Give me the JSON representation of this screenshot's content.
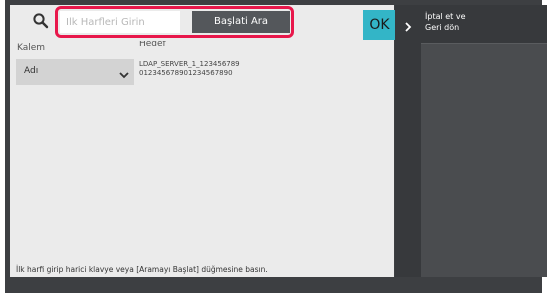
{
  "search": {
    "placeholder": "İlk Harfleri Girin",
    "value": "",
    "start_button_label": "Başlati Ara"
  },
  "ok_label": "OK",
  "columns": {
    "item_label": "Kalem",
    "target_label": "Hedef"
  },
  "item_select": {
    "selected": "Adı"
  },
  "server": {
    "line1": "LDAP_SERVER_1_123456789",
    "line2": "01234567890123456789​0"
  },
  "help_text": "İlk harfi girip harici klavye veya [Aramayı Başlat] düğmesine basın.",
  "side": {
    "cancel_line1": "İptal et ve",
    "cancel_line2": "Geri dön"
  },
  "icons": {
    "search": "search-icon",
    "dropdown": "chevron-down-icon",
    "back": "chevron-right-icon"
  },
  "colors": {
    "highlight": "#e8174b",
    "ok_button": "#33b5c7",
    "start_button": "#54575b"
  }
}
